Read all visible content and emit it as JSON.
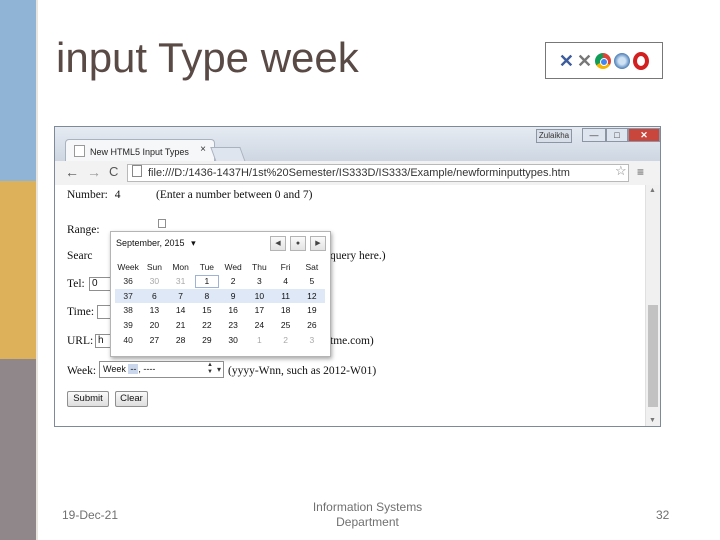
{
  "slide": {
    "title": "input Type week",
    "footer_date": "19-Dec-21",
    "footer_center": "Information Systems Department",
    "slide_number": "32",
    "logos": [
      "ie-x-icon",
      "x-icon",
      "chrome-icon",
      "safari-icon",
      "opera-icon"
    ],
    "colors": {
      "bar_blue": "#8fb4d6",
      "bar_yellow": "#ddb05a",
      "bar_gray": "#8f8789",
      "title_text": "#5a4a46"
    }
  },
  "browser": {
    "tab_title": "New HTML5 Input Types",
    "tab_close": "×",
    "user_button": "Zulaikha",
    "window_buttons": {
      "minimize": "—",
      "maximize": "□",
      "close": "✕"
    },
    "address": "file:///D:/1436-1437H/1st%20Semester/IS333D/IS333/Example/newforminputtypes.htm",
    "nav": {
      "back": "←",
      "forward": "→",
      "reload": "C"
    }
  },
  "form": {
    "number": {
      "label": "Number:",
      "value": "4",
      "hint": "(Enter a number between 0 and 7)"
    },
    "range": {
      "label": "Range:"
    },
    "search": {
      "label": "Searc",
      "hint_tail": "query here.)"
    },
    "tel": {
      "label": "Tel:",
      "value": "0"
    },
    "time": {
      "label": "Time:"
    },
    "url": {
      "label": "URL:",
      "value": "h",
      "hint_tail": "tme.com)"
    },
    "week": {
      "label": "Week:",
      "value_prefix": "Week",
      "value_segment": "--",
      "value_rest": ", ----",
      "hint": "(yyyy-Wnn, such as 2012-W01)"
    },
    "buttons": {
      "submit": "Submit",
      "clear": "Clear"
    }
  },
  "week_picker": {
    "month_label": "September, 2015",
    "dropdown_glyph": "▾",
    "nav": {
      "prev": "◀",
      "today": "●",
      "next": "▶"
    },
    "headers": [
      "Week",
      "Sun",
      "Mon",
      "Tue",
      "Wed",
      "Thu",
      "Fri",
      "Sat"
    ],
    "rows": [
      {
        "week": "36",
        "days": [
          "30",
          "31",
          "1",
          "2",
          "3",
          "4",
          "5"
        ]
      },
      {
        "week": "37",
        "days": [
          "6",
          "7",
          "8",
          "9",
          "10",
          "11",
          "12"
        ]
      },
      {
        "week": "38",
        "days": [
          "13",
          "14",
          "15",
          "16",
          "17",
          "18",
          "19"
        ]
      },
      {
        "week": "39",
        "days": [
          "20",
          "21",
          "22",
          "23",
          "24",
          "25",
          "26"
        ]
      },
      {
        "week": "40",
        "days": [
          "27",
          "28",
          "29",
          "30",
          "1",
          "2",
          "3"
        ]
      }
    ],
    "highlighted_week": "37",
    "today_day": "1"
  }
}
